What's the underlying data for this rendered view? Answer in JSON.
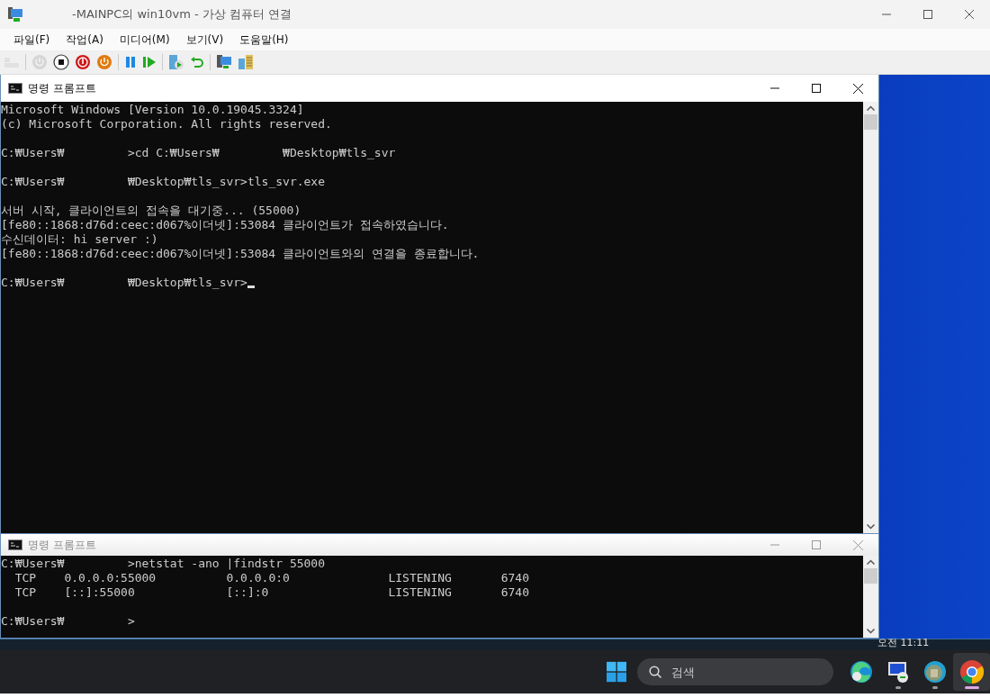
{
  "vm_window": {
    "title": "-MAINPC의 win10vm - 가상 컴퓨터 연결"
  },
  "menu": [
    "파일(F)",
    "작업(A)",
    "미디어(M)",
    "보기(V)",
    "도움말(H)"
  ],
  "toolbar": [
    {
      "kind": "keyboard",
      "disabled": true
    },
    {
      "kind": "start",
      "disabled": true
    },
    {
      "kind": "stop",
      "disabled": false
    },
    {
      "kind": "shutdown",
      "disabled": false
    },
    {
      "kind": "power",
      "disabled": false
    },
    {
      "kind": "pause",
      "disabled": false
    },
    {
      "kind": "resume",
      "disabled": false
    },
    {
      "kind": "checkpoint",
      "disabled": false
    },
    {
      "kind": "revert",
      "disabled": false
    },
    {
      "kind": "enhanced",
      "disabled": false
    },
    {
      "kind": "share",
      "disabled": false
    }
  ],
  "consoles": [
    {
      "title": "명령 프롬프트",
      "active": true,
      "cursor": true,
      "blocks": [
        [
          "Microsoft Windows [Version 10.0.19045.3324]",
          "(c) Microsoft Corporation. All rights reserved."
        ],
        [
          "C:₩Users₩         >cd C:₩Users₩         ₩Desktop₩tls_svr"
        ],
        [
          "C:₩Users₩         ₩Desktop₩tls_svr>tls_svr.exe"
        ],
        [
          "서버 시작, 클라이언트의 접속을 대기중... (55000)",
          "[fe80::1868:d76d:ceec:d067%이더넷]:53084 클라이언트가 접속하였습니다.",
          "수신데이터: hi server :)",
          "[fe80::1868:d76d:ceec:d067%이더넷]:53084 클라이언트와의 연결을 종료합니다."
        ],
        [
          "C:₩Users₩         ₩Desktop₩tls_svr>"
        ]
      ]
    },
    {
      "title": "명령 프롬프트",
      "active": false,
      "cursor": false,
      "blocks": [
        [
          "C:₩Users₩         >netstat -ano |findstr 55000",
          "  TCP    0.0.0.0:55000          0.0.0.0:0              LISTENING       6740",
          "  TCP    [::]:55000             [::]:0                 LISTENING       6740"
        ],
        [
          "C:₩Users₩         >"
        ]
      ]
    }
  ],
  "guest_clock": "오전 11:11",
  "taskbar": {
    "search": {
      "placeholder": "검색"
    },
    "apps": [
      {
        "kind": "edge",
        "running": false,
        "active": false
      },
      {
        "kind": "remote",
        "running": true,
        "active": false
      },
      {
        "kind": "edge-profile",
        "running": true,
        "active": false
      },
      {
        "kind": "chrome",
        "running": true,
        "active": true
      }
    ]
  }
}
